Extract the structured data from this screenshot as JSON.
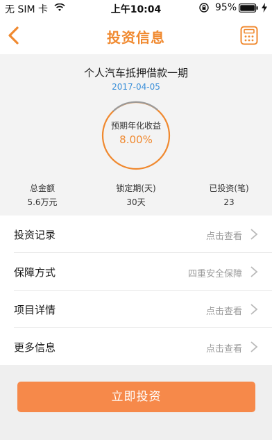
{
  "status_bar": {
    "carrier": "无 SIM 卡",
    "time": "上午10:04",
    "battery_percent": "95%"
  },
  "nav": {
    "title": "投资信息",
    "back_icon": "chevron-left-icon",
    "right_icon": "calculator-icon"
  },
  "product": {
    "name": "个人汽车抵押借款一期",
    "date": "2017-04-05",
    "rate_label": "预期年化收益",
    "rate_value": "8.00%"
  },
  "stats": [
    {
      "label": "总金额",
      "value": "5.6万元"
    },
    {
      "label": "锁定期(天)",
      "value": "30天"
    },
    {
      "label": "已投资(笔)",
      "value": "23"
    }
  ],
  "list": [
    {
      "name": "投资记录",
      "action": "点击查看"
    },
    {
      "name": "保障方式",
      "action": "四重安全保障"
    },
    {
      "name": "项目详情",
      "action": "点击查看"
    },
    {
      "name": "更多信息",
      "action": "点击查看"
    }
  ],
  "invest_button": "立即投资",
  "colors": {
    "accent": "#f0892f",
    "button": "#f6894a",
    "date": "#3a8fd9"
  }
}
